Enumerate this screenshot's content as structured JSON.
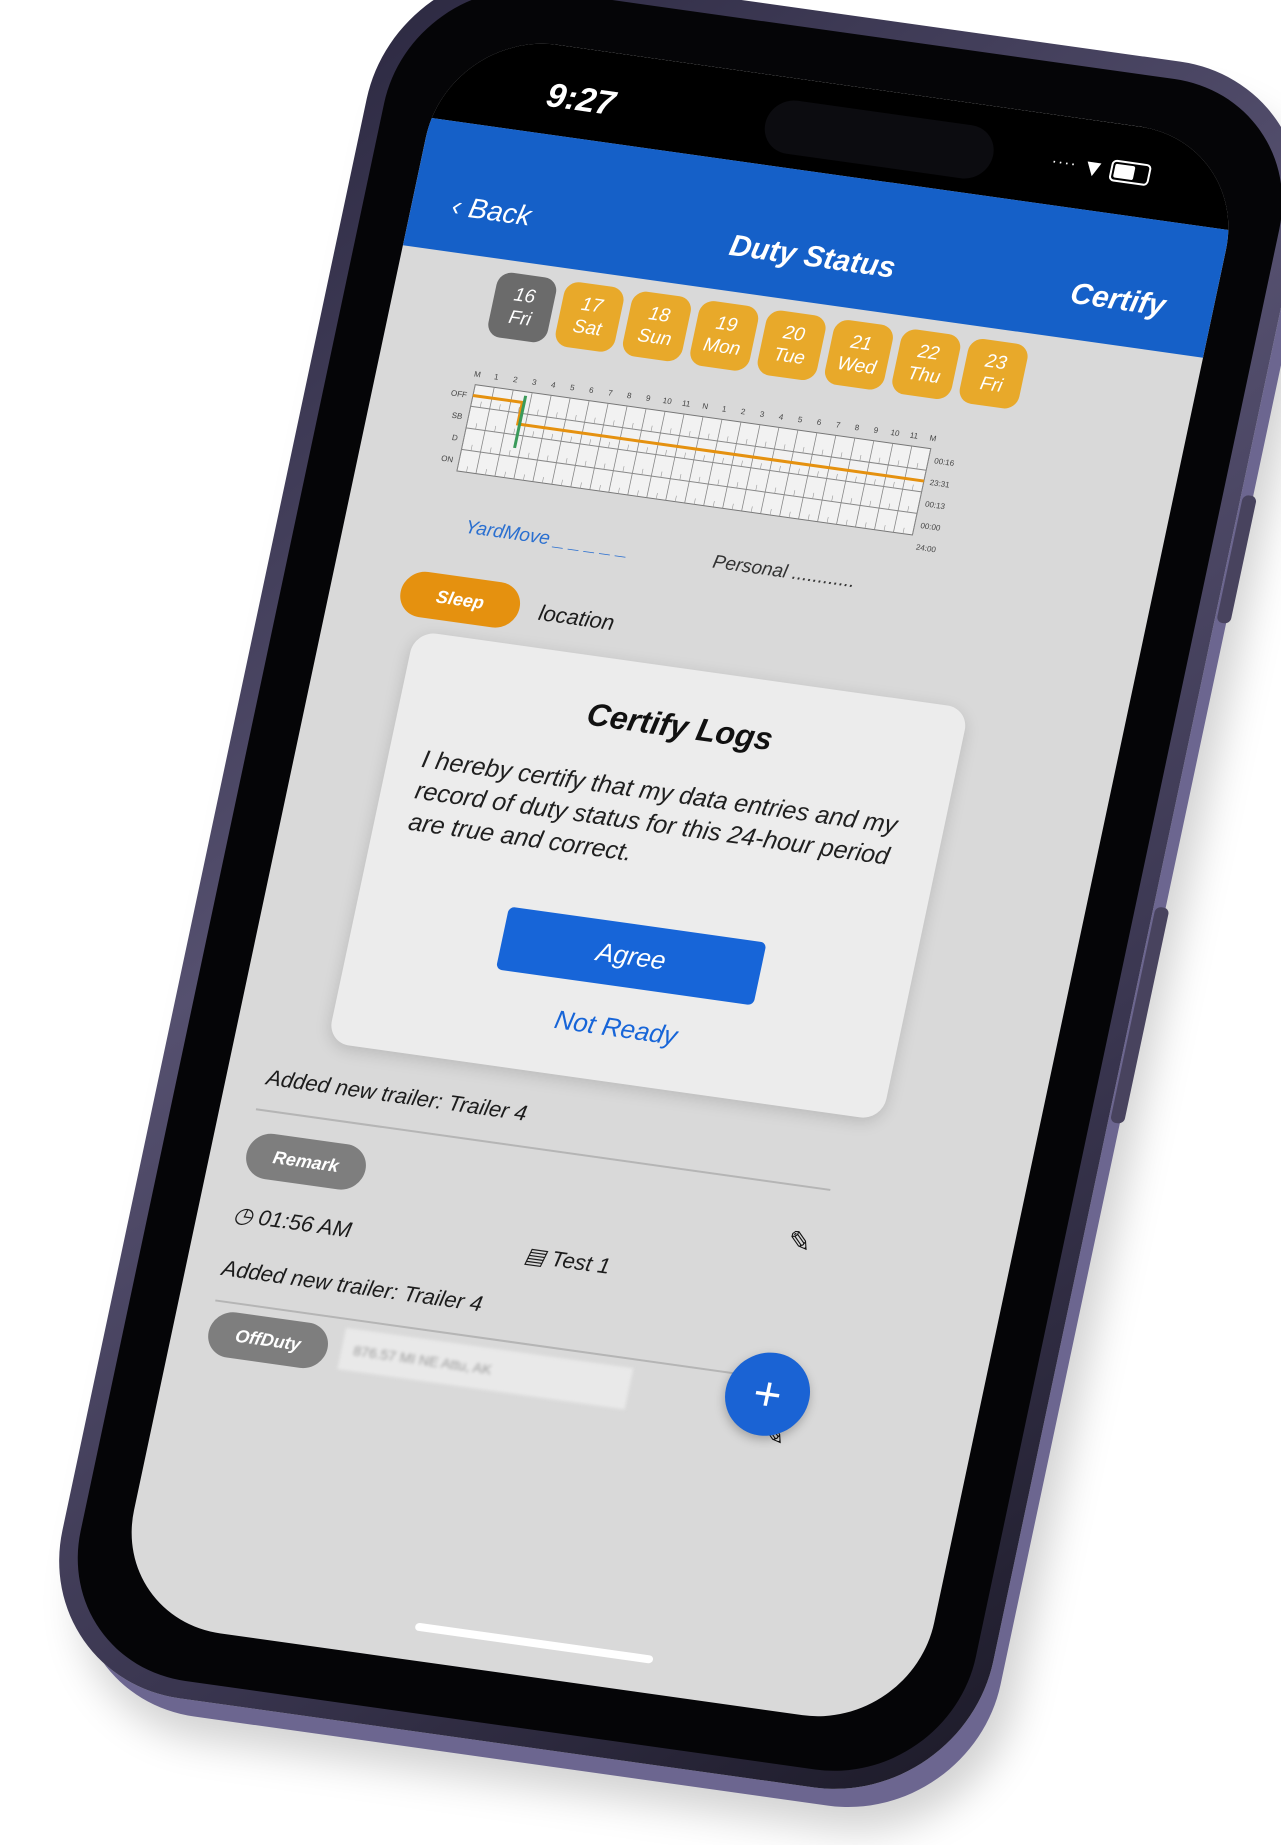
{
  "status_bar": {
    "time": "9:27"
  },
  "nav": {
    "back": "Back",
    "title": "Duty Status",
    "certify": "Certify"
  },
  "days": [
    {
      "num": "16",
      "dow": "Fri",
      "active": true
    },
    {
      "num": "17",
      "dow": "Sat"
    },
    {
      "num": "18",
      "dow": "Sun"
    },
    {
      "num": "19",
      "dow": "Mon"
    },
    {
      "num": "20",
      "dow": "Tue"
    },
    {
      "num": "21",
      "dow": "Wed"
    },
    {
      "num": "22",
      "dow": "Thu"
    },
    {
      "num": "23",
      "dow": "Fri"
    }
  ],
  "grid": {
    "rows": [
      "OFF",
      "SB",
      "D",
      "ON"
    ],
    "hours": [
      "M",
      "1",
      "2",
      "3",
      "4",
      "5",
      "6",
      "7",
      "8",
      "9",
      "10",
      "11",
      "N",
      "1",
      "2",
      "3",
      "4",
      "5",
      "6",
      "7",
      "8",
      "9",
      "10",
      "11",
      "M"
    ],
    "totals": [
      "00:16",
      "23:31",
      "00:13",
      "00:00",
      "24:00"
    ]
  },
  "legend": {
    "yard": "YardMove",
    "personal": "Personal"
  },
  "events": {
    "sleep_label": "Sleep",
    "sleep_location": "location",
    "trailer_1": "Added new trailer: Trailer 4",
    "remark_label": "Remark",
    "remark_time": "01:56 AM",
    "remark_test": "Test 1",
    "trailer_2": "Added new trailer: Trailer 4",
    "offduty_label": "OffDuty",
    "offduty_location": "876.57 MI NE Attu, AK"
  },
  "modal": {
    "title": "Certify Logs",
    "body": "I hereby certify that my data entries and my record of duty status for this 24-hour period are true and correct.",
    "agree": "Agree",
    "not_ready": "Not Ready"
  },
  "colors": {
    "primary": "#1560c8",
    "sleep": "#e5910f",
    "day": "#e8a92a",
    "day_active": "#6b6b6b"
  },
  "icons": {
    "back": "chevron-left-icon",
    "clock": "clock-icon",
    "doc": "document-icon",
    "edit": "pencil-icon",
    "add": "plus-icon"
  }
}
